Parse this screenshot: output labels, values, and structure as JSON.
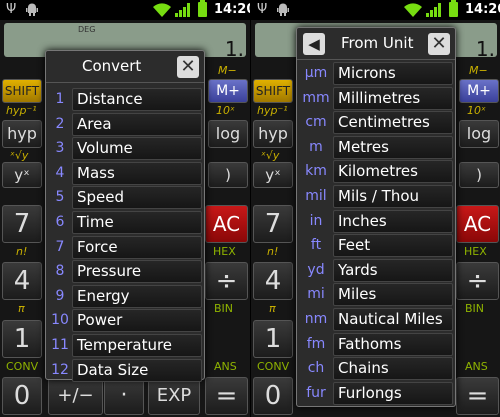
{
  "status": {
    "time": "14:20"
  },
  "display": {
    "mode": "DEG",
    "digit": "1."
  },
  "calc_background": {
    "shift": "SHIFT",
    "m_minus": "M−",
    "m_plus": "M+",
    "hyp_inv": "hyp⁻¹",
    "hyp": "hyp",
    "ten_x": "10ˣ",
    "log": "log",
    "root_x": "ˣ√y",
    "y_x": "yˣ",
    "paren_close": ")",
    "seven": "7",
    "ac": "AC",
    "n_fact": "n!",
    "hex": "HEX",
    "four": "4",
    "divide": "÷",
    "pi": "π",
    "bin": "BIN",
    "one": "1",
    "conv": "CONV",
    "ans": "ANS",
    "zero": "0",
    "plus_minus": "+/−",
    "dot": "·",
    "exp": "EXP",
    "equals": "="
  },
  "convert_dialog": {
    "title": "Convert",
    "items": [
      {
        "num": "1",
        "label": "Distance"
      },
      {
        "num": "2",
        "label": "Area"
      },
      {
        "num": "3",
        "label": "Volume"
      },
      {
        "num": "4",
        "label": "Mass"
      },
      {
        "num": "5",
        "label": "Speed"
      },
      {
        "num": "6",
        "label": "Time"
      },
      {
        "num": "7",
        "label": "Force"
      },
      {
        "num": "8",
        "label": "Pressure"
      },
      {
        "num": "9",
        "label": "Energy"
      },
      {
        "num": "10",
        "label": "Power"
      },
      {
        "num": "11",
        "label": "Temperature"
      },
      {
        "num": "12",
        "label": "Data Size"
      }
    ]
  },
  "unit_dialog": {
    "title": "From Unit",
    "items": [
      {
        "abbr": "µm",
        "label": "Microns"
      },
      {
        "abbr": "mm",
        "label": "Millimetres"
      },
      {
        "abbr": "cm",
        "label": "Centimetres"
      },
      {
        "abbr": "m",
        "label": "Metres"
      },
      {
        "abbr": "km",
        "label": "Kilometres"
      },
      {
        "abbr": "mil",
        "label": "Mils / Thou"
      },
      {
        "abbr": "in",
        "label": "Inches"
      },
      {
        "abbr": "ft",
        "label": "Feet"
      },
      {
        "abbr": "yd",
        "label": "Yards"
      },
      {
        "abbr": "mi",
        "label": "Miles"
      },
      {
        "abbr": "nm",
        "label": "Nautical Miles"
      },
      {
        "abbr": "fm",
        "label": "Fathoms"
      },
      {
        "abbr": "ch",
        "label": "Chains"
      },
      {
        "abbr": "fur",
        "label": "Furlongs"
      }
    ]
  },
  "colors": {
    "accent_blue": "#8888ff",
    "shift_yellow": "#c9b000",
    "ac_red": "#b01010",
    "battery_green": "#77dd11"
  },
  "icons": [
    "usb-icon",
    "android-icon",
    "wifi-icon",
    "signal-icon",
    "battery-icon",
    "close-icon",
    "back-arrow-icon"
  ]
}
